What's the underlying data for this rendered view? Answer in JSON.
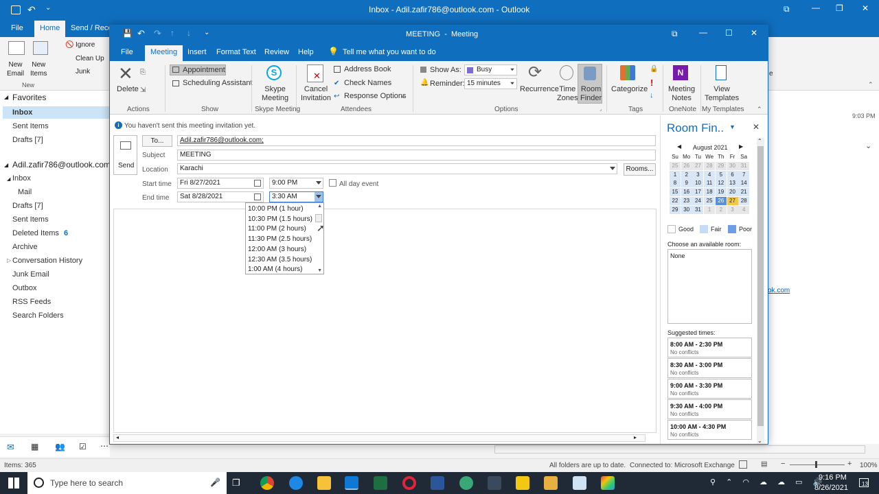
{
  "outlook": {
    "window_title": "Inbox - Adil.zafir786@outlook.com  -  Outlook",
    "tabs": [
      "File",
      "Home",
      "Send / Recei"
    ],
    "ribbon": {
      "new_email": "New\nEmail",
      "new_items": "New\nItems",
      "ignore": "Ignore",
      "clean_up": "Clean Up",
      "junk": "Junk",
      "group_new": "New"
    },
    "favorites": {
      "header": "Favorites",
      "items": [
        "Inbox",
        "Sent Items",
        "Drafts [7]"
      ]
    },
    "account": {
      "header": "Adil.zafir786@outlook.com",
      "inbox": "Inbox",
      "mail": "Mail",
      "drafts": "Drafts [7]",
      "sent": "Sent Items",
      "deleted": "Deleted Items",
      "deleted_count": "6",
      "archive": "Archive",
      "conversation": "Conversation History",
      "junk": "Junk Email",
      "outbox": "Outbox",
      "rss": "RSS Feeds",
      "search": "Search Folders"
    },
    "reading_pane": {
      "time": "9:03 PM",
      "link": "ok.com",
      "letter": "e"
    },
    "status": {
      "items": "Items: 365",
      "folders": "All folders are up to date.",
      "connected": "Connected to: Microsoft Exchange",
      "zoom": "100%"
    }
  },
  "meeting": {
    "title": "MEETING  -  Meeting",
    "tabs": [
      "File",
      "Meeting",
      "Insert",
      "Format Text",
      "Review",
      "Help"
    ],
    "tell_me": "Tell me what you want to do",
    "ribbon": {
      "delete": "Delete",
      "group_actions": "Actions",
      "appointment": "Appointment",
      "scheduling": "Scheduling Assistant",
      "group_show": "Show",
      "skype": "Skype\nMeeting",
      "group_skype": "Skype Meeting",
      "cancel": "Cancel\nInvitation",
      "address_book": "Address Book",
      "check_names": "Check Names",
      "response_options": "Response Options",
      "group_attendees": "Attendees",
      "show_as_label": "Show As:",
      "show_as_value": "Busy",
      "reminder_label": "Reminder:",
      "reminder_value": "15 minutes",
      "recurrence": "Recurrence",
      "time_zones": "Time\nZones",
      "room_finder": "Room\nFinder",
      "group_options": "Options",
      "categorize": "Categorize",
      "group_tags": "Tags",
      "meeting_notes": "Meeting\nNotes",
      "group_onenote": "OneNote",
      "view_templates": "View\nTemplates",
      "group_templates": "My Templates"
    },
    "info_bar": "You haven't sent this meeting invitation yet.",
    "form": {
      "send": "Send",
      "to_button": "To...",
      "to_value": "Adil.zafir786@outlook.com;",
      "subject_label": "Subject",
      "subject_value": "MEETING",
      "location_label": "Location",
      "location_value": "Karachi",
      "rooms_button": "Rooms...",
      "start_label": "Start time",
      "start_date": "Fri 8/27/2021",
      "start_time": "9:00 PM",
      "all_day": "All day event",
      "end_label": "End time",
      "end_date": "Sat 8/28/2021",
      "end_time": "3:30 AM"
    },
    "end_time_options": [
      "10:00 PM  (1 hour)",
      "10:30 PM  (1.5 hours)",
      "11:00 PM  (2 hours)",
      "11:30 PM  (2.5 hours)",
      "12:00 AM  (3 hours)",
      "12:30 AM  (3.5 hours)",
      "1:00 AM  (4 hours)"
    ],
    "room_finder": {
      "title": "Room Fin..",
      "month": "August 2021",
      "weekdays": [
        "Su",
        "Mo",
        "Tu",
        "We",
        "Th",
        "Fr",
        "Sa"
      ],
      "weeks": [
        [
          "25",
          "26",
          "27",
          "28",
          "29",
          "30",
          "31"
        ],
        [
          "1",
          "2",
          "3",
          "4",
          "5",
          "6",
          "7"
        ],
        [
          "8",
          "9",
          "10",
          "11",
          "12",
          "13",
          "14"
        ],
        [
          "15",
          "16",
          "17",
          "18",
          "19",
          "20",
          "21"
        ],
        [
          "22",
          "23",
          "24",
          "25",
          "26",
          "27",
          "28"
        ],
        [
          "29",
          "30",
          "31",
          "1",
          "2",
          "3",
          "4"
        ]
      ],
      "legend": [
        "Good",
        "Fair",
        "Poor"
      ],
      "choose_room_label": "Choose an available room:",
      "room_value": "None",
      "suggested_label": "Suggested times:",
      "suggested": [
        {
          "time": "8:00 AM - 2:30 PM",
          "status": "No conflicts"
        },
        {
          "time": "8:30 AM - 3:00 PM",
          "status": "No conflicts"
        },
        {
          "time": "9:00 AM - 3:30 PM",
          "status": "No conflicts"
        },
        {
          "time": "9:30 AM - 4:00 PM",
          "status": "No conflicts"
        },
        {
          "time": "10:00 AM - 4:30 PM",
          "status": "No conflicts"
        }
      ]
    }
  },
  "taskbar": {
    "search_placeholder": "Type here to search",
    "time": "9:16 PM",
    "date": "8/26/2021",
    "notifications": "13"
  },
  "colors": {
    "accent": "#106ebe",
    "today": "#f2c744",
    "selected_day": "#5b8fd6"
  }
}
